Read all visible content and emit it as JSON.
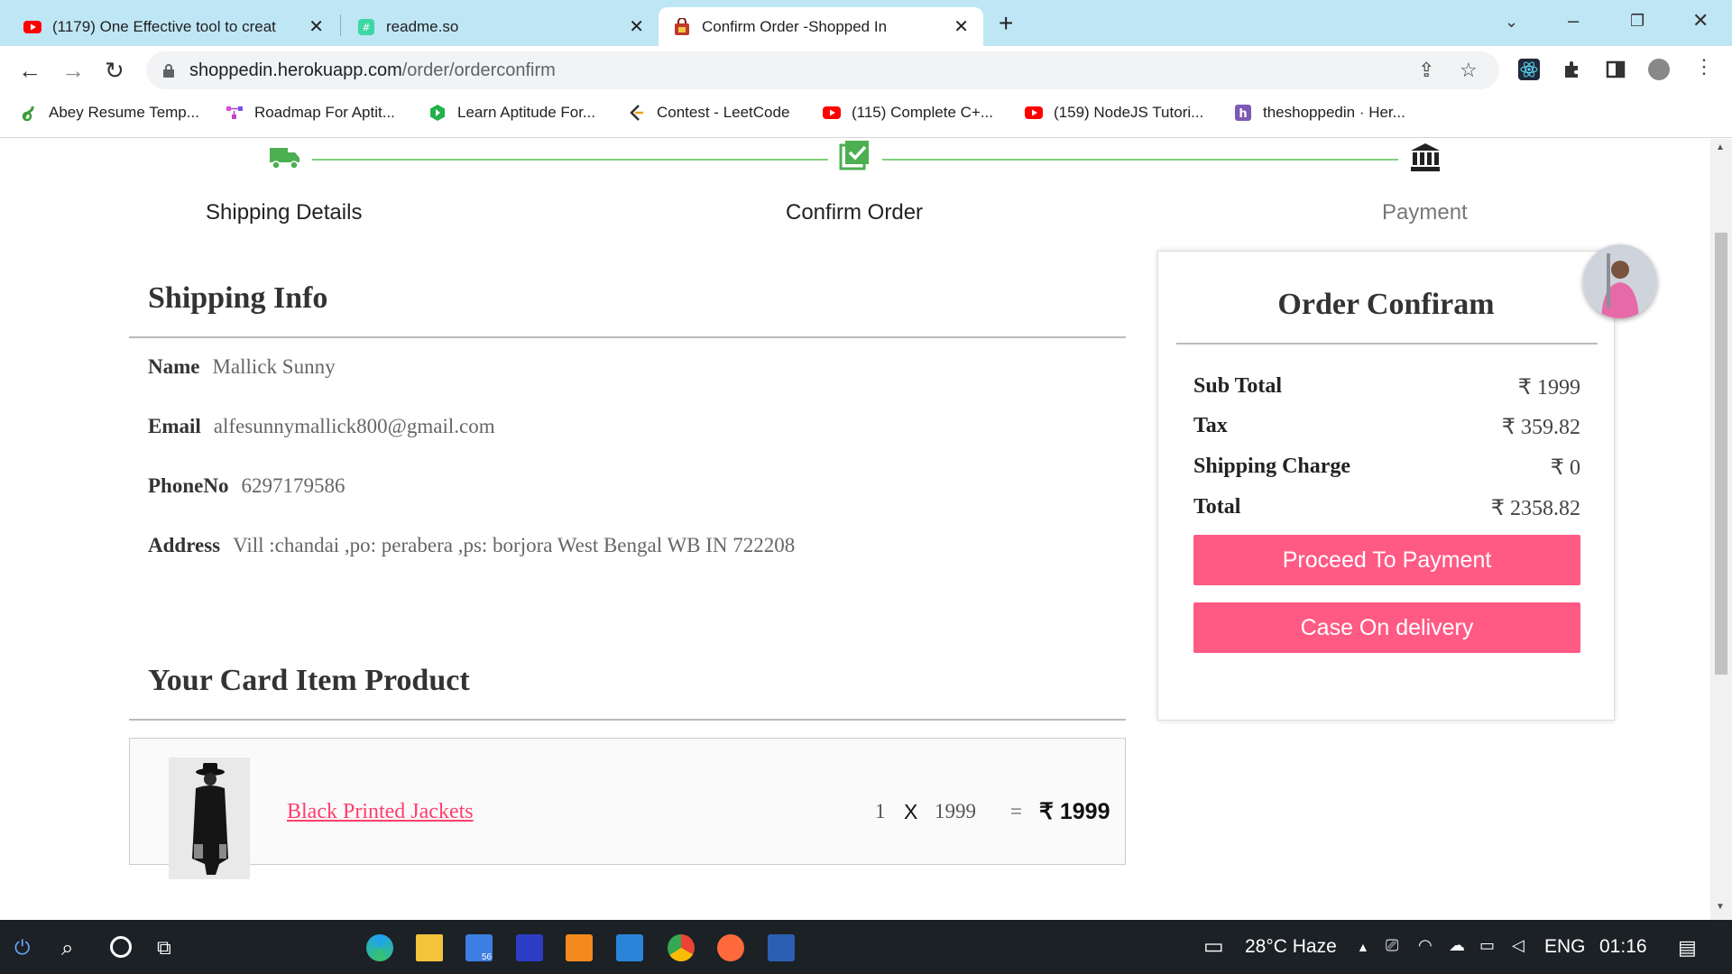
{
  "browser": {
    "tabs": [
      {
        "title": "(1179) One Effective tool to creat",
        "icon": "youtube-icon"
      },
      {
        "title": "readme.so",
        "icon": "readme-icon"
      },
      {
        "title": "Confirm Order -Shopped In",
        "icon": "shop-bag-icon",
        "active": true
      }
    ],
    "url": {
      "host": "shoppedin.herokuapp.com",
      "path": "/order/orderconfirm"
    },
    "bookmarks": [
      {
        "label": "Abey Resume Temp...",
        "icon": "resume-icon"
      },
      {
        "label": "Roadmap For Aptit...",
        "icon": "roadmap-icon"
      },
      {
        "label": "Learn Aptitude For...",
        "icon": "aptitude-icon"
      },
      {
        "label": "Contest - LeetCode",
        "icon": "leetcode-icon"
      },
      {
        "label": "(115) Complete C+...",
        "icon": "youtube-icon"
      },
      {
        "label": "(159) NodeJS Tutori...",
        "icon": "youtube-icon"
      },
      {
        "label": "theshoppedin · Her...",
        "icon": "heroku-icon"
      }
    ]
  },
  "stepper": {
    "steps": [
      {
        "label": "Shipping Details",
        "icon": "truck-icon"
      },
      {
        "label": "Confirm Order",
        "icon": "checklist-icon"
      },
      {
        "label": "Payment",
        "icon": "bank-icon"
      }
    ]
  },
  "shipping": {
    "title": "Shipping Info",
    "name_label": "Name",
    "name": "Mallick Sunny",
    "email_label": "Email",
    "email": "alfesunnymallick800@gmail.com",
    "phone_label": "PhoneNo",
    "phone": "6297179586",
    "address_label": "Address",
    "address": "Vill :chandai ,po: perabera ,ps: borjora West Bengal WB IN 722208"
  },
  "cart": {
    "title": "Your Card Item Product",
    "items": [
      {
        "name": "Black Printed Jackets",
        "qty": "1",
        "x": "X",
        "price": "1999",
        "eq": "=",
        "total": "₹ 1999"
      }
    ]
  },
  "order": {
    "title": "Order Confiram",
    "rows": [
      {
        "label": "Sub Total",
        "value": "₹ 1999"
      },
      {
        "label": "Tax",
        "value": "₹ 359.82"
      },
      {
        "label": "Shipping Charge",
        "value": "₹ 0"
      },
      {
        "label": "Total",
        "value": "₹ 2358.82"
      }
    ],
    "pay_button": "Proceed To Payment",
    "cod_button": "Case On delivery"
  },
  "taskbar": {
    "weather": "28°C  Haze",
    "lang": "ENG",
    "time": "01:16",
    "edge_badge": "56"
  },
  "colors": {
    "accent": "#ff5a84",
    "step_done": "#4caf50",
    "tab_bg": "#bfe6f4"
  }
}
